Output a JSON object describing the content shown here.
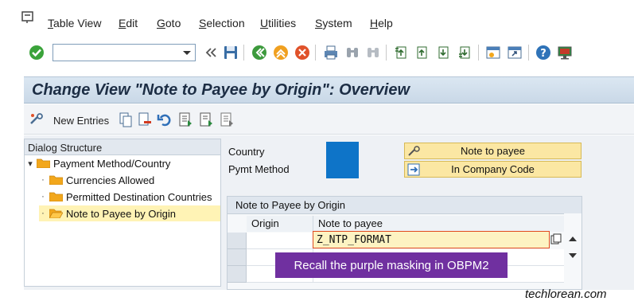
{
  "menu": {
    "items": [
      {
        "label_u": "T",
        "label_rest": "able View"
      },
      {
        "label_u": "E",
        "label_rest": "dit"
      },
      {
        "label_u": "G",
        "label_rest": "oto"
      },
      {
        "label_u": "S",
        "label_rest": "election"
      },
      {
        "label_u": "U",
        "label_rest": "tilities"
      },
      {
        "label_u": "S",
        "label_rest": "ystem"
      },
      {
        "label_u": "H",
        "label_rest": "elp"
      }
    ]
  },
  "toolbar": {
    "command_field_value": "",
    "icons": [
      "enter-icon",
      "back-double-arrow-icon",
      "save-icon",
      "back-icon",
      "exit-icon",
      "cancel-icon",
      "print-icon",
      "find-icon",
      "find-next-icon",
      "first-page-icon",
      "previous-page-icon",
      "next-page-icon",
      "last-page-icon",
      "create-session-icon",
      "shortcut-icon",
      "help-icon",
      "customize-layout-icon"
    ]
  },
  "title": "Change View \"Note to Payee by Origin\": Overview",
  "app_toolbar": {
    "new_entries_label": "New Entries"
  },
  "dialog_structure": {
    "header": "Dialog Structure",
    "items": [
      {
        "label": "Payment Method/Country",
        "level": 0
      },
      {
        "label": "Currencies Allowed",
        "level": 1
      },
      {
        "label": "Permitted Destination Countries",
        "level": 1
      },
      {
        "label": "Note to Payee by Origin",
        "level": 1
      }
    ]
  },
  "keys": {
    "country_label": "Country",
    "pymt_method_label": "Pymt Method"
  },
  "buttons": {
    "note_to_payee": "Note to payee",
    "in_company_code": "In Company Code"
  },
  "table": {
    "title": "Note to Payee by Origin",
    "columns": [
      "Origin",
      "Note to payee"
    ],
    "rows": [
      {
        "origin": "",
        "note_to_payee": "Z_NTP_FORMAT"
      }
    ]
  },
  "overlay_text": "Recall the purple masking in OBPM2",
  "watermark": "techlorean.com",
  "colors": {
    "mask_blue": "#0e74c8",
    "mask_purple": "#7030a0",
    "button_yellow": "#fbe7a3"
  }
}
